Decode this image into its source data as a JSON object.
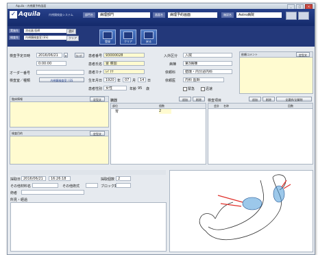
{
  "window": {
    "title": "Aquila - 内視鏡予約画面"
  },
  "header": {
    "brand": "Aquila",
    "brand_sub": "内視鏡検査システム",
    "dept_label": "部門名",
    "dept_value": "病理部門",
    "screen_label": "画面名",
    "screen_value": "病理予約画面",
    "facility_label": "施設名",
    "facility_value": "Astro病院"
  },
  "toolbar": {
    "field1_label": "実施先",
    "field1_value": "消化器 医師",
    "field2_label": "検査先",
    "field2_value": "内視鏡検査室 [ES]",
    "select_btn": "選択",
    "clear_btn": "クリア",
    "btn_register": "登録",
    "btn_clear": "クリア",
    "btn_back": "戻る"
  },
  "form": {
    "date_label": "検査予定日時",
    "date_value": "2016/06/21",
    "time_value": "0:00:00",
    "sel_btn": "ｶﾚﾝﾀﾞ",
    "order_label": "オーダー番号",
    "type_label": "検査室／種類",
    "type_value": "内視鏡検査室 / ES",
    "patient_no_label": "患者番号",
    "patient_no_value": "93000028",
    "patient_name_label": "患者氏名",
    "patient_name_value": "霊 菜加",
    "patient_kana_label": "患者カナ",
    "patient_kana_value": "ﾚｲ ﾅﾅ",
    "birth_label": "生年月日",
    "birth_year": "1920",
    "birth_year_unit": "年",
    "birth_month": "07",
    "birth_month_unit": "月",
    "birth_day": "14",
    "birth_day_unit": "日",
    "sex_label": "患者性別",
    "sex_value": "女性",
    "age_label": "年齢",
    "age_value": "95",
    "age_unit": "歳",
    "admit_label": "入外区分",
    "admit_value": "入院",
    "ward_label": "病棟",
    "ward_value": "第3病棟",
    "req_dept_label": "依頼科",
    "req_dept_value": "循環・内分泌内科",
    "req_doc_label": "依頼医",
    "req_doc_value": "内科 医師",
    "urgent_label": "緊急",
    "fast_label": "迅速"
  },
  "comment_panel": {
    "title": "依頼コメント",
    "btn": "定型文"
  },
  "left_panels": {
    "clinical_title": "臨床情報",
    "clinical_btn": "定型文",
    "purpose_title": "検査目的",
    "purpose_btn": "定型文"
  },
  "organ_table": {
    "title": "臓器",
    "add_btn": "追加",
    "del_btn": "削除",
    "col_part": "部位",
    "col_count": "個数",
    "rows": [
      {
        "part": "胃",
        "count": "2"
      }
    ]
  },
  "items_table": {
    "title": "検査項目",
    "add_btn": "追加",
    "del_btn": "削除",
    "all_btn": "全選択/全解除",
    "col_code": "会計",
    "col_name": "名称",
    "col_count": "回数"
  },
  "bottom": {
    "date_label": "採取日",
    "date_value": "2016/06/21",
    "time_value": "16:26:18",
    "count_label": "採取個数",
    "count_value": "2",
    "other1_label": "その他材料名",
    "other2_label": "その他術式",
    "block_label": "ブロック数",
    "method_label": "術者",
    "findings_label": "所見・経過"
  },
  "colors": {
    "header": "#1f3a80",
    "toolbar": "#23387a",
    "yellow": "#fffbd0",
    "arrow": "#e0302a",
    "lesion": "#4a9ad8"
  }
}
